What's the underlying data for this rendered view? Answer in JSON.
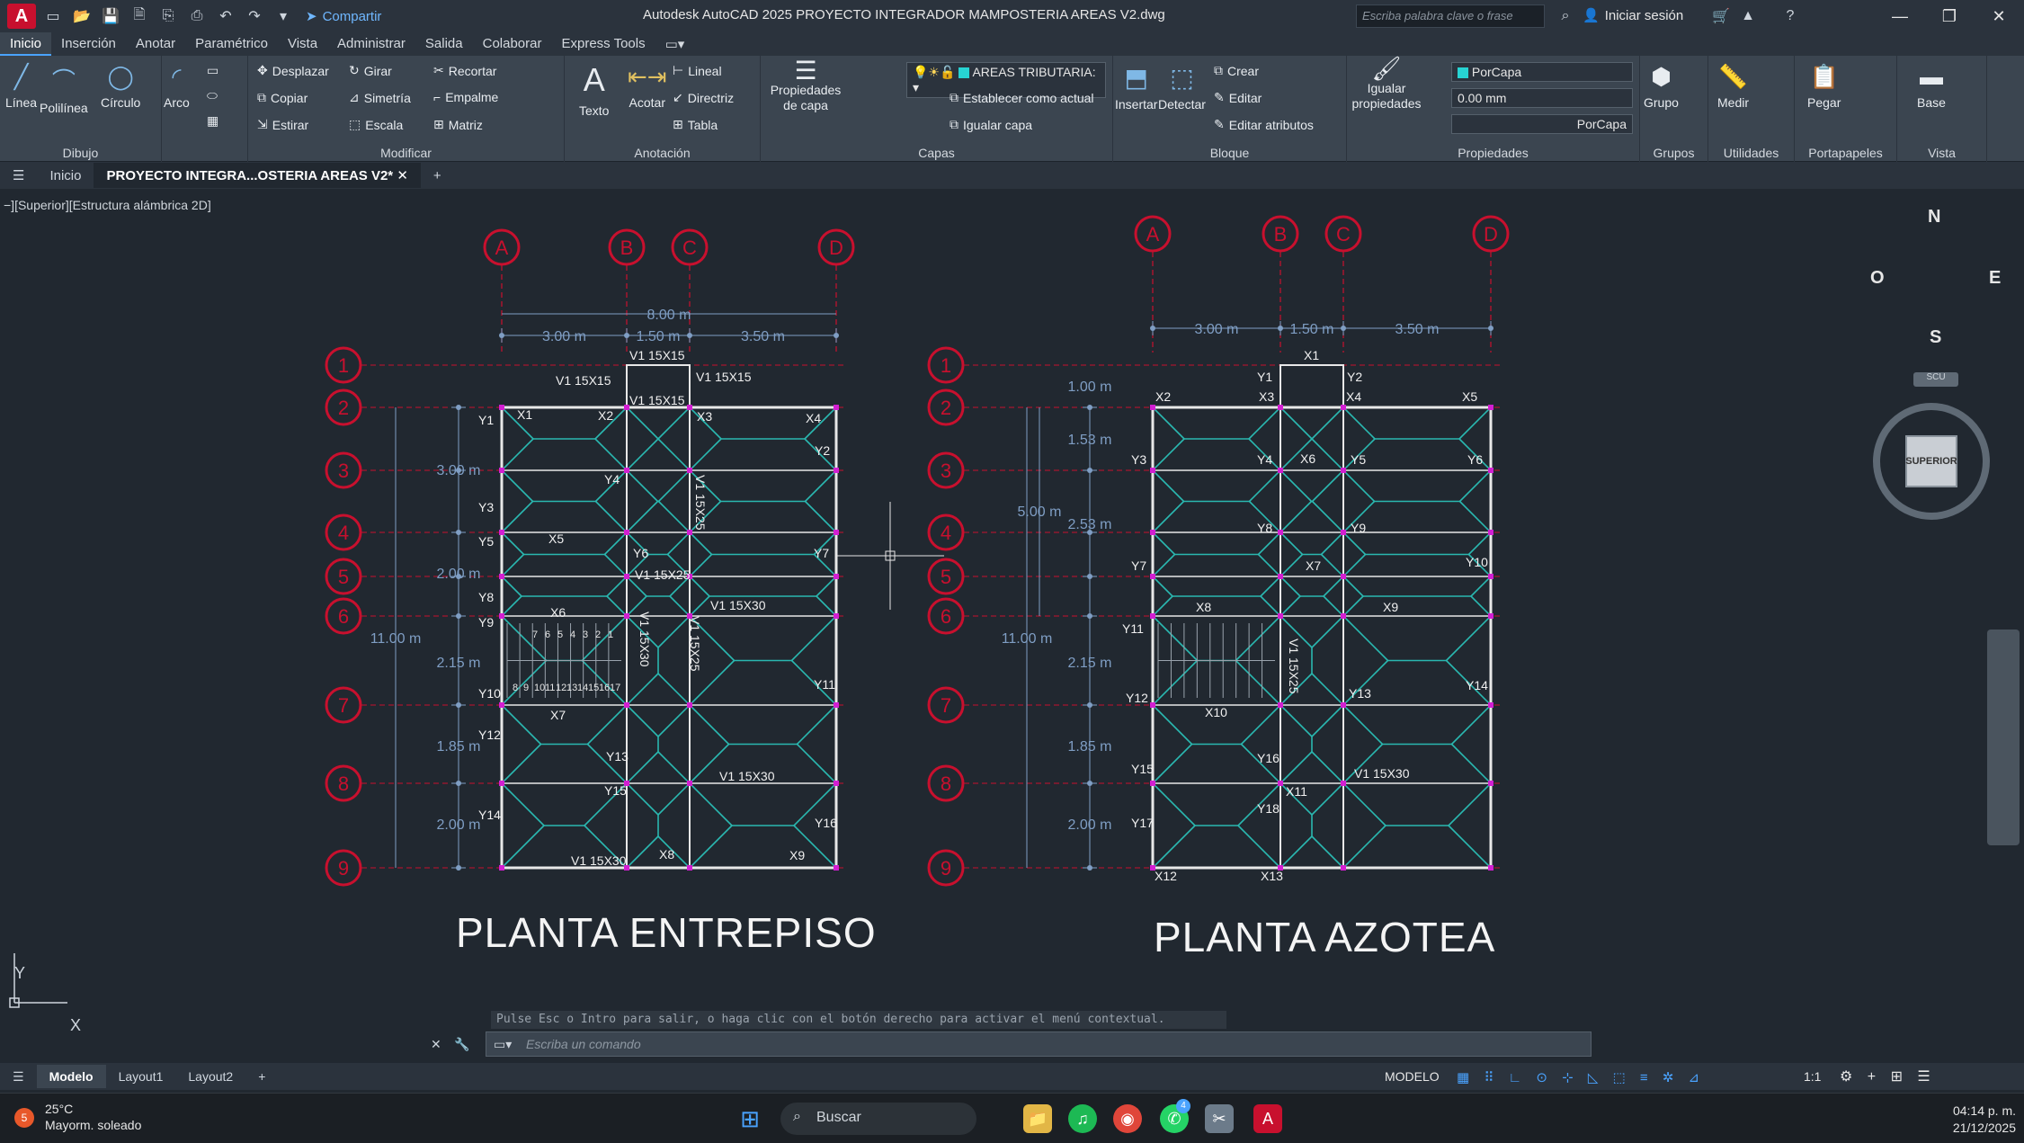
{
  "titlebar": {
    "logo": "A",
    "share_label": "Compartir",
    "app_title": "Autodesk AutoCAD 2025   PROYECTO INTEGRADOR MAMPOSTERIA AREAS V2.dwg",
    "search_placeholder": "Escriba palabra clave o frase",
    "signin_label": "Iniciar sesión"
  },
  "ribbon_tabs": [
    "Inicio",
    "Inserción",
    "Anotar",
    "Paramétrico",
    "Vista",
    "Administrar",
    "Salida",
    "Colaborar",
    "Express Tools"
  ],
  "ribbon": {
    "dibujo": {
      "title": "Dibujo",
      "linea": "Línea",
      "polilinea": "Polilínea",
      "circulo": "Círculo",
      "arco": "Arco"
    },
    "modificar": {
      "title": "Modificar",
      "desplazar": "Desplazar",
      "girar": "Girar",
      "recortar": "Recortar",
      "copiar": "Copiar",
      "simetria": "Simetría",
      "empalme": "Empalme",
      "estirar": "Estirar",
      "escala": "Escala",
      "matriz": "Matriz"
    },
    "anotacion": {
      "title": "Anotación",
      "texto": "Texto",
      "acotar": "Acotar",
      "lineal": "Lineal",
      "directriz": "Directriz",
      "tabla": "Tabla"
    },
    "capas": {
      "title": "Capas",
      "propiedades": "Propiedades de capa",
      "layer_value": "AREAS TRIBUTARIA:",
      "establecer": "Establecer como actual",
      "igualar": "Igualar capa"
    },
    "bloque": {
      "title": "Bloque",
      "insertar": "Insertar",
      "detectar": "Detectar",
      "crear": "Crear",
      "editar": "Editar",
      "editar_atributos": "Editar atributos"
    },
    "propiedades": {
      "title": "Propiedades",
      "igualar": "Igualar propiedades",
      "color_value": "PorCapa",
      "lineweight_value": "0.00 mm",
      "linetype_value": "PorCapa"
    },
    "grupos": {
      "title": "Grupos",
      "grupo": "Grupo"
    },
    "utilidades": {
      "title": "Utilidades",
      "medir": "Medir"
    },
    "portapapeles": {
      "title": "Portapapeles",
      "pegar": "Pegar"
    },
    "vista": {
      "title": "Vista",
      "base": "Base"
    }
  },
  "doc_tabs": {
    "home": "Inicio",
    "active": "PROYECTO INTEGRA...OSTERIA AREAS V2*"
  },
  "viewport": {
    "label": "−][Superior][Estructura alámbrica 2D]",
    "compass": {
      "n": "N",
      "s": "S",
      "e": "E",
      "o": "O",
      "center": "SUPERIOR",
      "ucs": "SCU"
    },
    "plan1_title": "PLANTA ENTREPISO",
    "plan2_title": "PLANTA AZOTEA",
    "col_axes": [
      "A",
      "B",
      "C",
      "D"
    ],
    "row_axes": [
      "1",
      "2",
      "3",
      "4",
      "5",
      "6",
      "7",
      "8",
      "9"
    ],
    "plan1_dims_top": {
      "total": "8.00 m",
      "d1": "3.00 m",
      "d2": "1.50 m",
      "d3": "3.50 m"
    },
    "plan1_dims_left": {
      "total": "11.00 m",
      "d1": "3.00 m",
      "d2": "2.00 m",
      "d3": "2.15 m",
      "d4": "1.85 m",
      "d5": "2.00 m"
    },
    "plan2_dims_top": {
      "d1": "3.00 m",
      "d2": "1.50 m",
      "d3": "3.50 m"
    },
    "plan2_dims_left": {
      "total": "11.00 m",
      "a": "1.00 m",
      "b": "1.53 m",
      "c": "5.00 m",
      "d": "2.53 m",
      "e": "2.15 m",
      "f": "1.85 m",
      "g": "2.00 m"
    },
    "plan1_labels": [
      {
        "t": "V1 15X15"
      },
      {
        "t": "V1 15X15"
      },
      {
        "t": "V1 15X15"
      },
      {
        "t": "V1 15X15"
      },
      {
        "t": "X1"
      },
      {
        "t": "X2"
      },
      {
        "t": "X3"
      },
      {
        "t": "X4"
      },
      {
        "t": "X5"
      },
      {
        "t": "X6"
      },
      {
        "t": "X7"
      },
      {
        "t": "X8"
      },
      {
        "t": "X9"
      },
      {
        "t": "Y1"
      },
      {
        "t": "Y2"
      },
      {
        "t": "Y3"
      },
      {
        "t": "Y4"
      },
      {
        "t": "Y5"
      },
      {
        "t": "Y6"
      },
      {
        "t": "Y7"
      },
      {
        "t": "Y8"
      },
      {
        "t": "Y9"
      },
      {
        "t": "Y10"
      },
      {
        "t": "Y11"
      },
      {
        "t": "Y12"
      },
      {
        "t": "Y13"
      },
      {
        "t": "Y14"
      },
      {
        "t": "Y15"
      },
      {
        "t": "Y16"
      },
      {
        "t": "V1 15X25"
      },
      {
        "t": "V1 15X25"
      },
      {
        "t": "V1 15X30"
      },
      {
        "t": "V1 15X30"
      },
      {
        "t": "V1 15X25"
      },
      {
        "t": "V1 15X30"
      },
      {
        "t": "V1 15X30"
      }
    ],
    "plan2_labels": [
      {
        "t": "X1"
      },
      {
        "t": "X2"
      },
      {
        "t": "X3"
      },
      {
        "t": "X4"
      },
      {
        "t": "X5"
      },
      {
        "t": "X6"
      },
      {
        "t": "X7"
      },
      {
        "t": "X8"
      },
      {
        "t": "X9"
      },
      {
        "t": "X10"
      },
      {
        "t": "X11"
      },
      {
        "t": "X12"
      },
      {
        "t": "X13"
      },
      {
        "t": "Y1"
      },
      {
        "t": "Y2"
      },
      {
        "t": "Y3"
      },
      {
        "t": "Y4"
      },
      {
        "t": "Y5"
      },
      {
        "t": "Y6"
      },
      {
        "t": "Y7"
      },
      {
        "t": "Y8"
      },
      {
        "t": "Y9"
      },
      {
        "t": "Y10"
      },
      {
        "t": "Y11"
      },
      {
        "t": "Y12"
      },
      {
        "t": "Y13"
      },
      {
        "t": "Y14"
      },
      {
        "t": "Y15"
      },
      {
        "t": "Y16"
      },
      {
        "t": "Y17"
      },
      {
        "t": "Y18"
      },
      {
        "t": "V1 15X25"
      },
      {
        "t": "V1 15X30"
      }
    ],
    "stairs_numbers": [
      "7",
      "6",
      "5",
      "4",
      "3",
      "2",
      "1",
      "8",
      "9",
      "10",
      "11",
      "12",
      "13",
      "14",
      "15",
      "16",
      "17"
    ]
  },
  "command": {
    "hint": "Pulse Esc o Intro para salir, o haga clic con el botón derecho para activar el menú contextual.",
    "placeholder": "Escriba un comando"
  },
  "layout_tabs": [
    "Modelo",
    "Layout1",
    "Layout2"
  ],
  "status": {
    "model": "MODELO",
    "scale": "1:1"
  },
  "taskbar": {
    "weather_temp": "25°C",
    "weather_desc": "Mayorm. soleado",
    "weather_badge": "5",
    "search": "Buscar",
    "whatsapp_badge": "4",
    "time": "04:14 p. m.",
    "date": "21/12/2025"
  },
  "colors": {
    "grid": "#c8102e",
    "walls": "#e8e8e8",
    "tributary": "#2ab8b0",
    "dims": "#7f9ec4",
    "magenta": "#d21fd2"
  }
}
